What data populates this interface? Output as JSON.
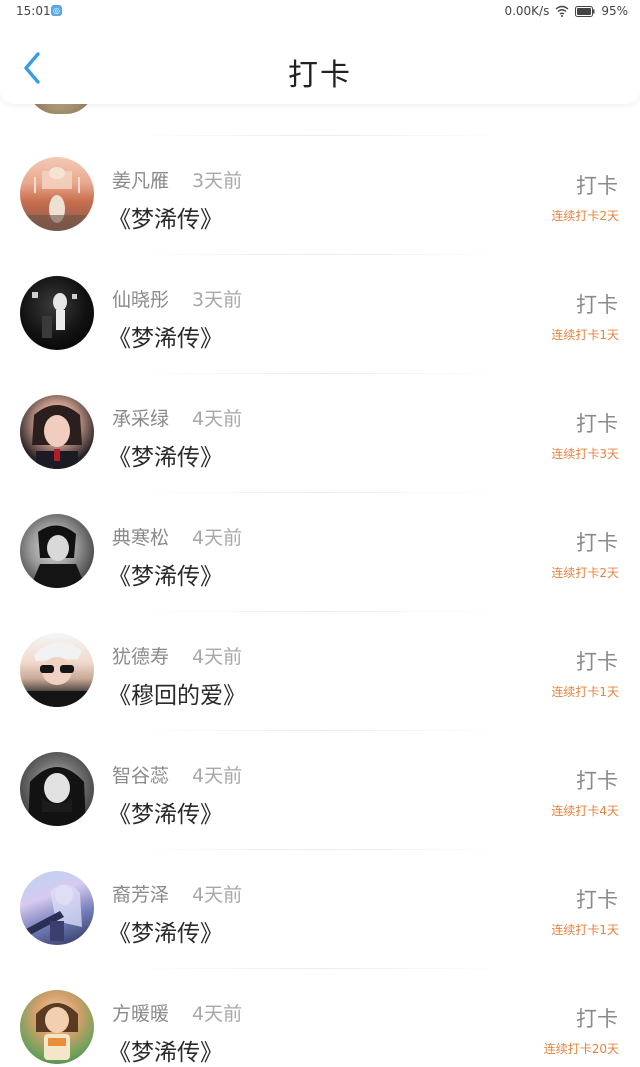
{
  "status_bar": {
    "time": "15:01",
    "network_speed": "0.00K/s",
    "battery_percent": "95%",
    "icons": [
      "app-notification-icon",
      "wifi-icon",
      "battery-icon"
    ]
  },
  "header": {
    "title": "打卡",
    "back_icon": "chevron-left-icon"
  },
  "colors": {
    "accent_blue": "#3a9be6",
    "streak_orange": "#e9823f",
    "name_gray": "#8a8a8a",
    "title_black": "#2a2a2a"
  },
  "checkins": [
    {
      "name": "姜凡雁",
      "time_ago": "3天前",
      "book": "《梦浠传》",
      "action": "打卡",
      "streak": "连续打卡2天"
    },
    {
      "name": "仙晓彤",
      "time_ago": "3天前",
      "book": "《梦浠传》",
      "action": "打卡",
      "streak": "连续打卡1天"
    },
    {
      "name": "承采绿",
      "time_ago": "4天前",
      "book": "《梦浠传》",
      "action": "打卡",
      "streak": "连续打卡3天"
    },
    {
      "name": "典寒松",
      "time_ago": "4天前",
      "book": "《梦浠传》",
      "action": "打卡",
      "streak": "连续打卡2天"
    },
    {
      "name": "犹德寿",
      "time_ago": "4天前",
      "book": "《穆回的爱》",
      "action": "打卡",
      "streak": "连续打卡1天"
    },
    {
      "name": "智谷蕊",
      "time_ago": "4天前",
      "book": "《梦浠传》",
      "action": "打卡",
      "streak": "连续打卡4天"
    },
    {
      "name": "裔芳泽",
      "time_ago": "4天前",
      "book": "《梦浠传》",
      "action": "打卡",
      "streak": "连续打卡1天"
    },
    {
      "name": "方暖暖",
      "time_ago": "4天前",
      "book": "《梦浠传》",
      "action": "打卡",
      "streak": "连续打卡20天"
    }
  ]
}
